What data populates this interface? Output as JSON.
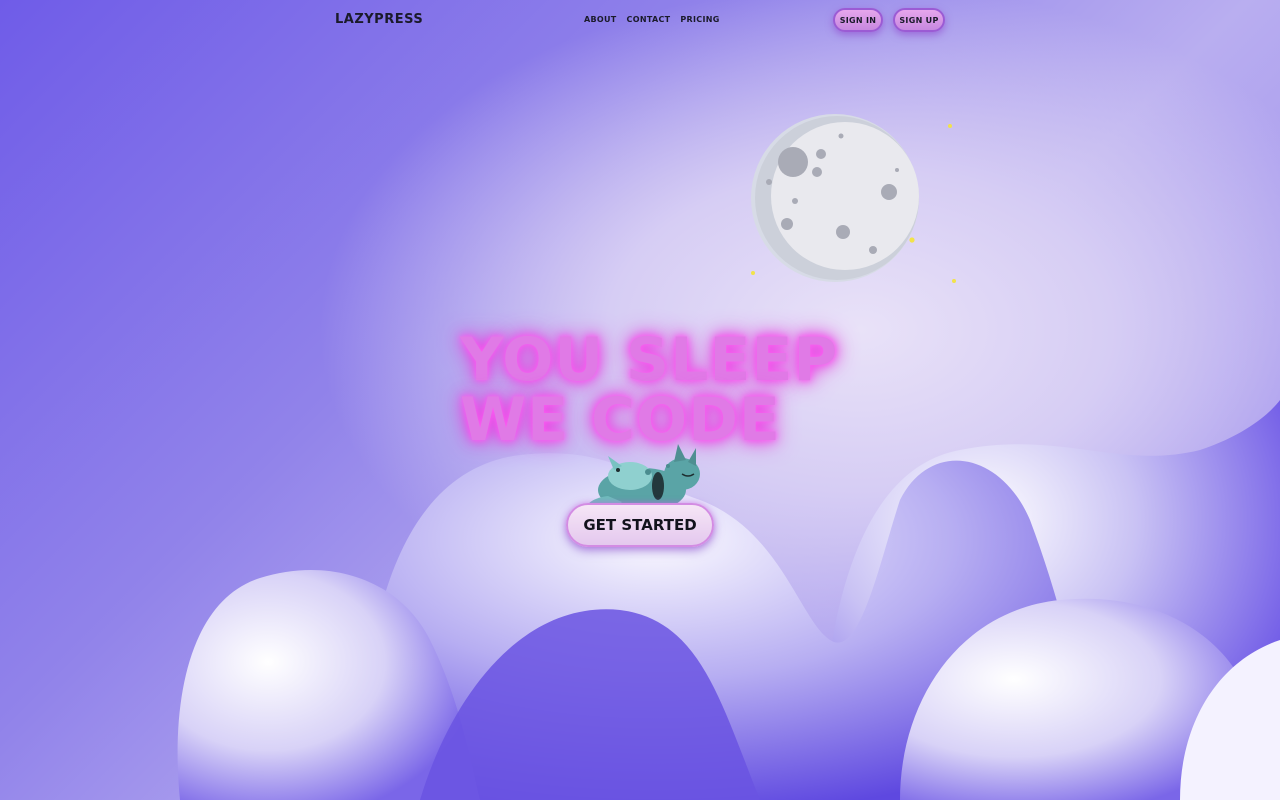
{
  "brand": {
    "logo_text": "LAZYPRESS"
  },
  "nav": {
    "links": [
      {
        "label": "ABOUT"
      },
      {
        "label": "CONTACT"
      },
      {
        "label": "PRICING"
      }
    ],
    "sign_in_label": "SIGN IN",
    "sign_up_label": "SIGN UP"
  },
  "hero": {
    "headline_line1": "YOU SLEEP",
    "headline_line2": "WE CODE",
    "cta_label": "GET STARTED"
  },
  "colors": {
    "background_primary": "#7b68ee",
    "headline_neon": "#e07ae6",
    "button_fill": "#e6a6ec",
    "button_border": "#9b5bd4",
    "moon": "#e6e6ea",
    "stars": "#f2e34a"
  },
  "icons": [
    "moon-icon",
    "star-icon",
    "sleeping-cat-illustration",
    "cloud-shapes"
  ]
}
